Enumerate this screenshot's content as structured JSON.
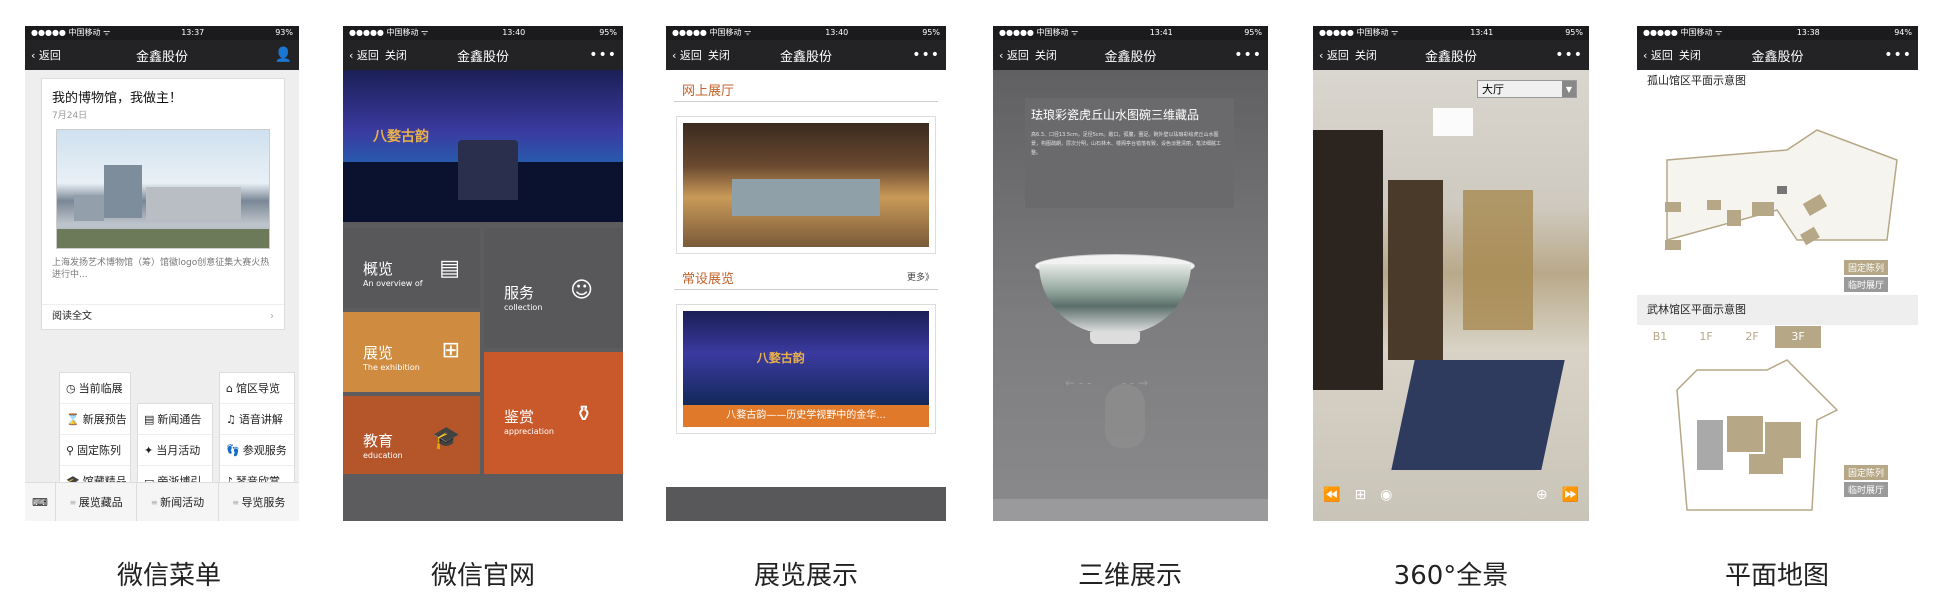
{
  "status": {
    "carrier": "●●●●● 中国移动 ᯤ"
  },
  "phones": [
    {
      "time": "13:37",
      "battery": "93%",
      "back": "返回",
      "close": "",
      "title": "金鑫股份",
      "right": "👤"
    },
    {
      "time": "13:40",
      "battery": "95%",
      "back": "返回",
      "close": "关闭",
      "title": "金鑫股份",
      "right": "•••"
    },
    {
      "time": "13:40",
      "battery": "95%",
      "back": "返回",
      "close": "关闭",
      "title": "金鑫股份",
      "right": "•••"
    },
    {
      "time": "13:41",
      "battery": "95%",
      "back": "返回",
      "close": "关闭",
      "title": "金鑫股份",
      "right": "•••"
    },
    {
      "time": "13:41",
      "battery": "95%",
      "back": "返回",
      "close": "关闭",
      "title": "金鑫股份",
      "right": "•••"
    },
    {
      "time": "13:38",
      "battery": "94%",
      "back": "返回",
      "close": "关闭",
      "title": "金鑫股份",
      "right": "•••"
    }
  ],
  "captions": [
    "微信菜单",
    "微信官网",
    "展览展示",
    "三维展示",
    "360°全景",
    "平面地图"
  ],
  "menu_page": {
    "card_title": "我的博物馆，我做主！",
    "card_date": "7月24日",
    "card_desc": "上海发扬艺术博物馆（筹）馆徽logo创意征集大赛火热进行中...",
    "read_more": "阅读全文",
    "col_left": [
      "当前临展",
      "新展预告",
      "固定陈列",
      "馆藏精品"
    ],
    "col_mid": [
      "新闻通告",
      "当月活动",
      "旁浙博引"
    ],
    "col_right": [
      "馆区导览",
      "语音讲解",
      "参观服务",
      "琴音欣赏"
    ],
    "tabs": [
      "展览藏品",
      "新闻活动",
      "导览服务"
    ]
  },
  "site_page": {
    "banner_text": "八婺古韵",
    "tiles": [
      {
        "cn": "概览",
        "en": "An overview of"
      },
      {
        "cn": "服务",
        "en": "collection"
      },
      {
        "cn": "展览",
        "en": "The exhibition"
      },
      {
        "cn": "鉴赏",
        "en": "appreciation"
      },
      {
        "cn": "教育",
        "en": "education"
      }
    ]
  },
  "expo_page": {
    "section1": "网上展厅",
    "section2": "常设展览",
    "more": "更多》",
    "banner_caption": "八婺古韵——历史学视野中的金华...",
    "banner_text": "八婺古韵"
  },
  "threed_page": {
    "title": "珐琅彩瓷虎丘山水图碗三维藏品",
    "desc": "高6.3、口径13.5cm，足径5cm。敞口，弧腹，圈足。碗外壁以珐琅彩绘虎丘山水图景，构图疏朗，层次分明，山石林木、楼阁亭台错落有致，设色淡雅清丽，笔法细腻工整。"
  },
  "pano_page": {
    "hall_select": "大厅"
  },
  "map_page": {
    "map1_title": "孤山馆区平面示意图",
    "map2_title": "武林馆区平面示意图",
    "floors": [
      "B1",
      "1F",
      "2F",
      "3F"
    ],
    "legend_fixed": "固定陈列",
    "legend_temp": "临时展厅"
  },
  "colors": {
    "nav": "#232325",
    "accent_orange": "#c4622a",
    "tile_gray": "#58585a",
    "tile_amber": "#cf8b3f",
    "tile_orange": "#c9592b",
    "tile_rust": "#b4552a",
    "map_tan": "#b6a886"
  }
}
